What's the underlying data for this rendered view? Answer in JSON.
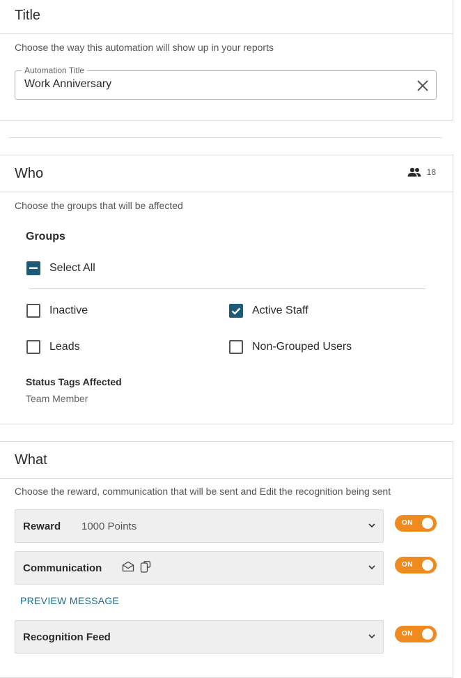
{
  "title_card": {
    "heading": "Title",
    "description": "Choose the way this automation will show up in your reports",
    "field_label": "Automation Title",
    "field_value": "Work Anniversary"
  },
  "who_card": {
    "heading": "Who",
    "user_count": "18",
    "description": "Choose the groups that will be affected",
    "groups_label": "Groups",
    "select_all_label": "Select All",
    "select_all_state": "indeterminate",
    "groups": [
      {
        "label": "Inactive",
        "checked": false
      },
      {
        "label": "Active Staff",
        "checked": true
      },
      {
        "label": "Leads",
        "checked": false
      },
      {
        "label": "Non-Grouped Users",
        "checked": false
      }
    ],
    "status_tags_label": "Status Tags Affected",
    "status_tags_value": "Team Member"
  },
  "what_card": {
    "heading": "What",
    "description": "Choose the reward, communication that will be sent and Edit the recognition being sent",
    "rows": [
      {
        "title": "Reward",
        "value": "1000 Points",
        "toggle": "ON"
      },
      {
        "title": "Communication",
        "icons": [
          "envelope-icon",
          "chat-icon"
        ],
        "toggle": "ON"
      },
      {
        "title": "Recognition Feed",
        "toggle": "ON"
      }
    ],
    "preview_link": "PREVIEW MESSAGE"
  },
  "colors": {
    "accent": "#1e5a78",
    "toggle_on": "#ef8a1f",
    "link": "#1e6a8f"
  }
}
